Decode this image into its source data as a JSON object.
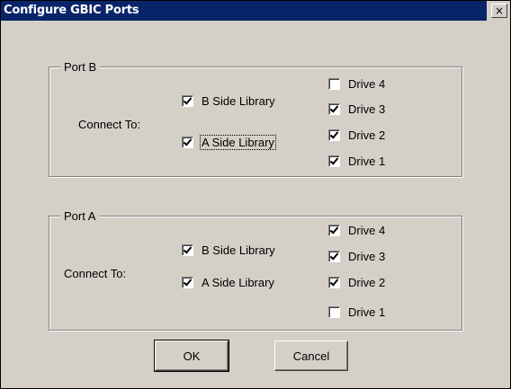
{
  "window": {
    "title": "Configure GBIC Ports",
    "close_glyph": "×"
  },
  "port_b": {
    "legend": "Port B",
    "connect_to_label": "Connect To:",
    "libraries": [
      {
        "label": "B Side Library",
        "checked": true
      },
      {
        "label": "A Side Library",
        "checked": true
      }
    ],
    "drives": [
      {
        "label": "Drive 4",
        "checked": false
      },
      {
        "label": "Drive 3",
        "checked": true
      },
      {
        "label": "Drive 2",
        "checked": true
      },
      {
        "label": "Drive 1",
        "checked": true
      }
    ]
  },
  "port_a": {
    "legend": "Port A",
    "connect_to_label": "Connect To:",
    "libraries": [
      {
        "label": "B Side Library",
        "checked": true
      },
      {
        "label": "A Side Library",
        "checked": true
      }
    ],
    "drives": [
      {
        "label": "Drive 4",
        "checked": true
      },
      {
        "label": "Drive 3",
        "checked": true
      },
      {
        "label": "Drive 2",
        "checked": true
      },
      {
        "label": "Drive 1",
        "checked": false
      }
    ]
  },
  "buttons": {
    "ok_label": "OK",
    "cancel_label": "Cancel"
  },
  "colors": {
    "title_bar": "#0a246a",
    "dialog_face": "#d4d0c8"
  }
}
